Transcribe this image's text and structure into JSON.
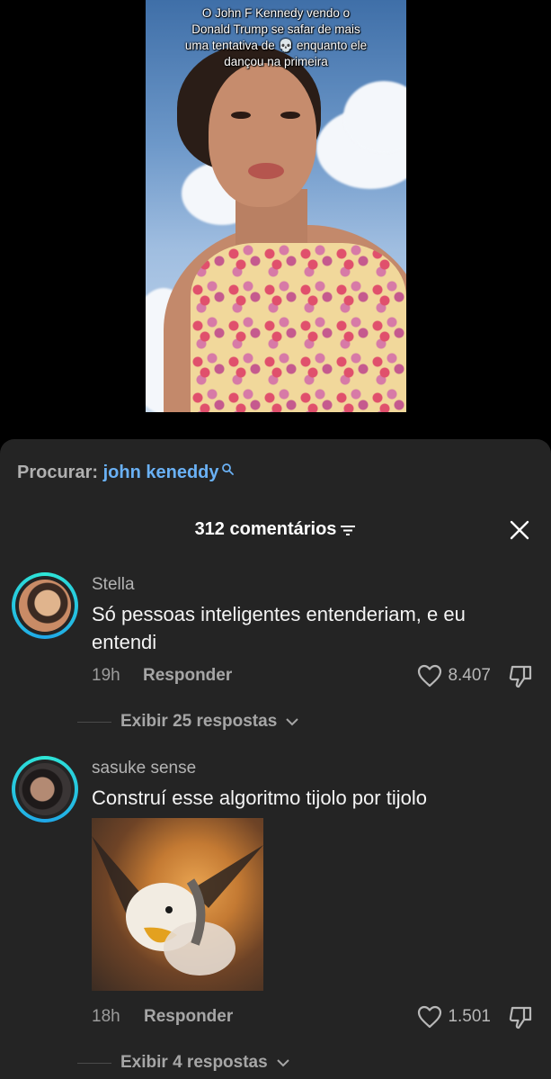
{
  "video": {
    "caption": "O John F Kennedy vendo o Donald Trump se safar de mais uma tentativa de 💀 enquanto ele dançou na primeira"
  },
  "search": {
    "prefix": "Procurar:",
    "term": "john keneddy"
  },
  "header": {
    "count_label": "312 comentários"
  },
  "comments": [
    {
      "username": "Stella",
      "text": "Só pessoas inteligentes entenderiam, e eu entendi",
      "time": "19h",
      "reply_label": "Responder",
      "likes": "8.407",
      "view_replies": "Exibir 25 respostas"
    },
    {
      "username": "sasuke sense",
      "text": "Construí esse algoritmo tijolo por tijolo",
      "time": "18h",
      "reply_label": "Responder",
      "likes": "1.501",
      "view_replies": "Exibir 4 respostas"
    }
  ],
  "colors": {
    "sheet_bg": "#242424",
    "search_term": "#6ab1f5",
    "avatar_ring": "#2ee6d6"
  }
}
